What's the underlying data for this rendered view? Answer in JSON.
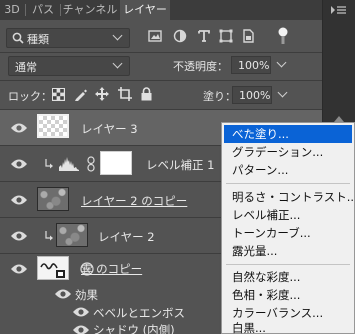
{
  "tabs": [
    {
      "label": "3D",
      "active": false
    },
    {
      "label": "パス",
      "active": false
    },
    {
      "label": "チャンネル",
      "active": false
    },
    {
      "label": "レイヤー",
      "active": true
    }
  ],
  "filter": {
    "kind_label": "種類",
    "icons": [
      "image-filter-icon",
      "adjustment-filter-icon",
      "type-filter-icon",
      "shape-filter-icon",
      "smart-object-filter-icon",
      "filter-toggle-icon"
    ]
  },
  "blend": {
    "mode": "通常",
    "opacity_label": "不透明度：",
    "opacity_value": "100%"
  },
  "lock": {
    "label": "ロック：",
    "fill_label": "塗り：",
    "fill_value": "100%"
  },
  "layers": [
    {
      "name": "レイヤー 3",
      "type": "transparent"
    },
    {
      "name": "レベル補正 1",
      "type": "adjustment"
    },
    {
      "name": "レイヤー 2 のコピー",
      "type": "noise"
    },
    {
      "name": "レイヤー 2",
      "type": "noise"
    },
    {
      "name": "雲 のコピー",
      "type": "text-thumb"
    }
  ],
  "effects": {
    "label": "効果",
    "items": [
      "ベベルとエンボス",
      "シャドウ (内側)"
    ]
  },
  "context_menu": {
    "items": [
      "べた塗り...",
      "グラデーション...",
      "パターン...",
      "明るさ・コントラスト...",
      "レベル補正...",
      "トーンカーブ...",
      "露光量...",
      "自然な彩度...",
      "色相・彩度...",
      "カラーバランス...",
      "白黒..."
    ],
    "selected_index": 0
  },
  "colors": {
    "panel": "#535353",
    "tabbar": "#3c3c3c",
    "menu_highlight": "#0a63d6",
    "selected_row": "#646464"
  }
}
